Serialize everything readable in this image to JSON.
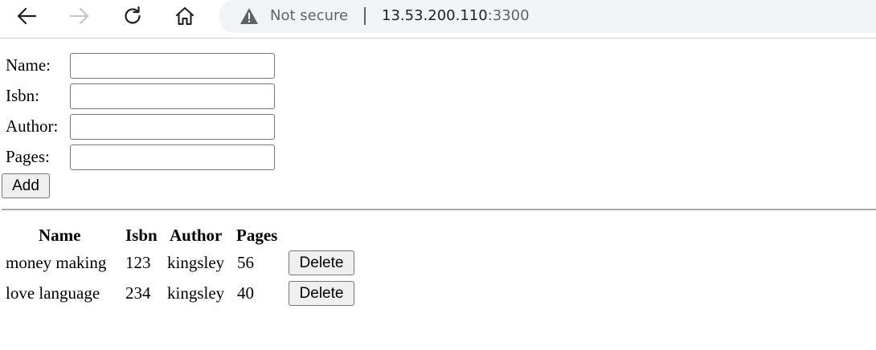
{
  "browser": {
    "security_label": "Not secure",
    "url_host": "13.53.200.110",
    "url_port": ":3300"
  },
  "form": {
    "fields": [
      {
        "label": "Name:",
        "value": ""
      },
      {
        "label": "Isbn:",
        "value": ""
      },
      {
        "label": "Author:",
        "value": ""
      },
      {
        "label": "Pages:",
        "value": ""
      }
    ],
    "add_label": "Add"
  },
  "table": {
    "headers": [
      "Name",
      "Isbn",
      "Author",
      "Pages"
    ],
    "rows": [
      {
        "name": "money making",
        "isbn": "123",
        "author": "kingsley",
        "pages": "56",
        "delete_label": "Delete"
      },
      {
        "name": "love language",
        "isbn": "234",
        "author": "kingsley",
        "pages": "40",
        "delete_label": "Delete"
      }
    ]
  },
  "colors": {
    "address_bar": "#f1f3f4",
    "button_bg": "#efefef",
    "muted_text": "#5f6368"
  }
}
